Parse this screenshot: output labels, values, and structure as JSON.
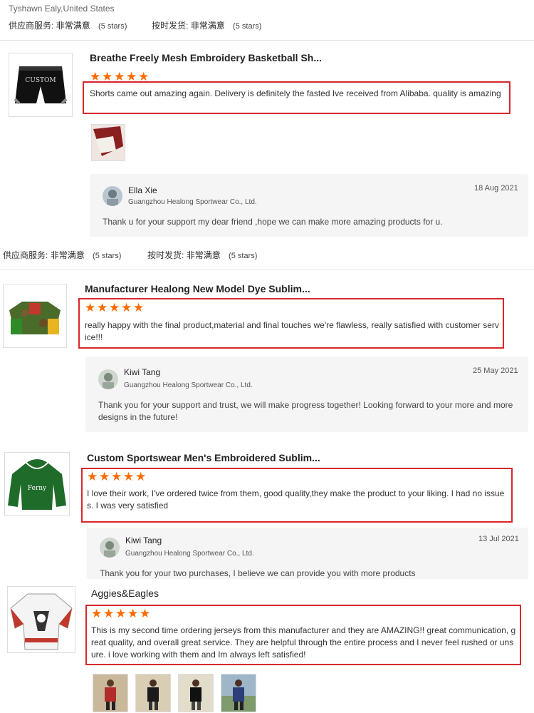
{
  "top": {
    "reviewer_location": "Tyshawn Ealy,United States",
    "supplier_service_label": "供应商服务:",
    "supplier_service_value": "非常满意",
    "supplier_service_stars": "(5 stars)",
    "ontime_label": "按时发货:",
    "ontime_value": "非常满意",
    "ontime_stars": "(5 stars)"
  },
  "reviews": [
    {
      "title": "Breathe Freely Mesh Embroidery Basketball Sh...",
      "text": "Shorts came out amazing again. Delivery is definitely the fasted Ive received from Alibaba. quality is amazing",
      "reply": {
        "name": "Ella Xie",
        "company": "Guangzhou Healong Sportwear Co., Ltd.",
        "date": "18 Aug 2021",
        "text": "Thank u for your support my dear friend ,hope we can make more amazing products for u."
      }
    },
    {
      "title": "Manufacturer Healong New Model Dye Sublim...",
      "text": "really happy with the final product,material and final touches we're flawless, really satisfied  with customer service!!!",
      "reply": {
        "name": "Kiwi Tang",
        "company": "Guangzhou Healong Sportwear Co., Ltd.",
        "date": "25 May 2021",
        "text": "Thank you for your support and trust, we will make progress together! Looking forward to your more and more designs in the future!"
      }
    },
    {
      "title": "Custom Sportswear Men's Embroidered Sublim...",
      "text": "I love their work, I've ordered twice from them,  good quality,they make the product to your liking. I had no issues. I was very satisfied",
      "reply": {
        "name": "Kiwi Tang",
        "company": "Guangzhou Healong Sportwear Co., Ltd.",
        "date": "13 Jul 2021",
        "text": "Thank you for your two purchases, I believe we can provide you with more products"
      }
    },
    {
      "title": "Aggies&Eagles",
      "text": "This is my second time ordering jerseys from this manufacturer and they are AMAZING!! great communication, great quality, and overall great service. They are helpful through the entire process and I never feel rushed or unsure. i love working with them and Im always left satisfied!"
    }
  ],
  "mid_rating": {
    "supplier_service_label": "供应商服务:",
    "supplier_service_value": "非常满意",
    "supplier_service_stars": "(5 stars)",
    "ontime_label": "按时发货:",
    "ontime_value": "非常满意",
    "ontime_stars": "(5 stars)"
  },
  "star_glyph": "★",
  "rating_stars": 5,
  "colors": {
    "star": "#ff6a00",
    "highlight_box": "#d9262c"
  }
}
